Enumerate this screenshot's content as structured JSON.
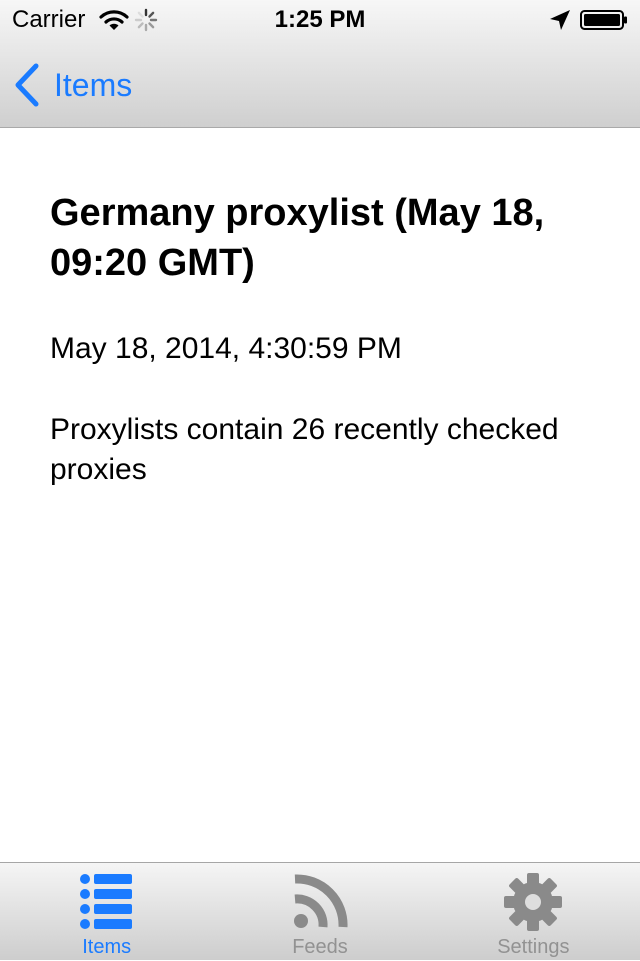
{
  "status_bar": {
    "carrier": "Carrier",
    "time": "1:25 PM",
    "icons": [
      "wifi-icon",
      "activity-spinner-icon",
      "location-arrow-icon",
      "battery-icon"
    ]
  },
  "nav": {
    "back_label": "Items",
    "back_icon": "chevron-left-icon",
    "accent_color": "#1a7bff"
  },
  "item": {
    "title": "Germany proxylist (May 18, 09:20 GMT)",
    "date": "May 18, 2014, 4:30:59 PM",
    "description": "Proxylists contain 26 recently checked proxies"
  },
  "tabs": [
    {
      "label": "Items",
      "icon": "list-icon",
      "active": true
    },
    {
      "label": "Feeds",
      "icon": "rss-feed-icon",
      "active": false
    },
    {
      "label": "Settings",
      "icon": "gear-icon",
      "active": false
    }
  ],
  "colors": {
    "active_tab": "#1a7bff",
    "inactive_tab": "#929292"
  }
}
